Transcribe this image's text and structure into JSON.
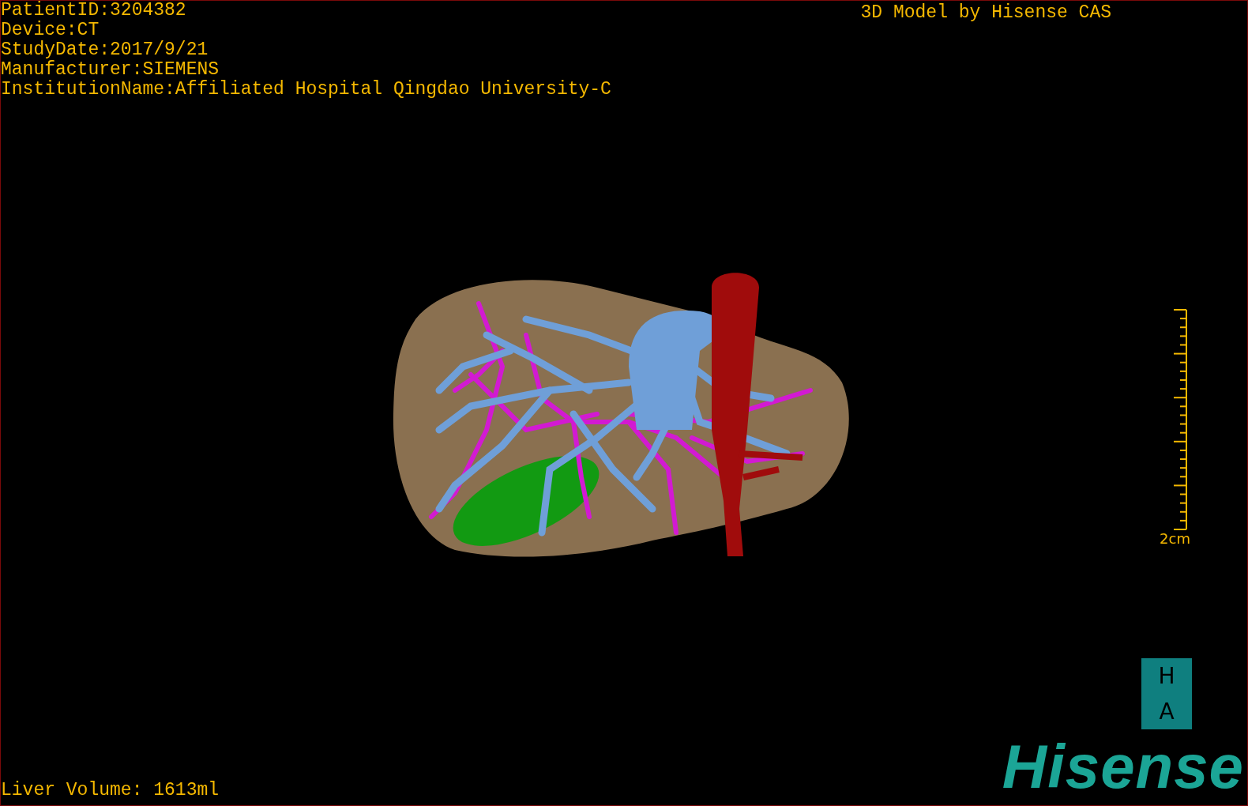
{
  "header": {
    "info_lines": [
      "PatientID:3204382",
      "Device:CT",
      "StudyDate:2017/9/21",
      "Manufacturer:SIEMENS",
      "InstitutionName:Affiliated Hospital Qingdao University-C"
    ],
    "title": "3D Model by Hisense CAS"
  },
  "scale_bar": {
    "label": "2cm"
  },
  "footer": {
    "liver_volume": "Liver Volume: 1613ml"
  },
  "logo": {
    "badge_letters": [
      "H",
      "A"
    ],
    "wordmark": "Hisense"
  }
}
